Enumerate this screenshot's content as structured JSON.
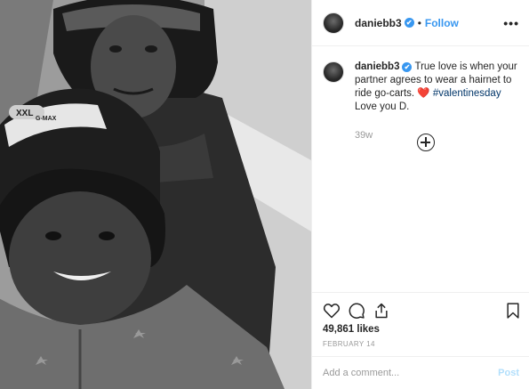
{
  "post": {
    "username": "daniebb3",
    "verified_mark": "✔",
    "separator": "•",
    "follow_label": "Follow",
    "more_label": "•••"
  },
  "caption": {
    "username": "daniebb3",
    "text_before": " True love is when your partner agrees to wear a hairnet to ride go-carts. ",
    "heart": "❤️",
    "hashtag": "#valentinesday",
    "text_after": " Love you D.",
    "time_ago": "39w"
  },
  "photo": {
    "helmet_label": "XXL",
    "helmet_brand": "G-MAX"
  },
  "engagement": {
    "likes": "49,861 likes",
    "date": "FEBRUARY 14"
  },
  "comment": {
    "placeholder": "Add a comment...",
    "post_label": "Post"
  },
  "colors": {
    "accent": "#3897f0",
    "hashtag": "#003569",
    "heart": "#ed4956",
    "post_disabled": "#b2dffc"
  },
  "icons": [
    "heart-icon",
    "comment-icon",
    "share-icon",
    "bookmark-icon",
    "plus-circle-icon",
    "verified-badge-icon",
    "more-options-icon"
  ]
}
